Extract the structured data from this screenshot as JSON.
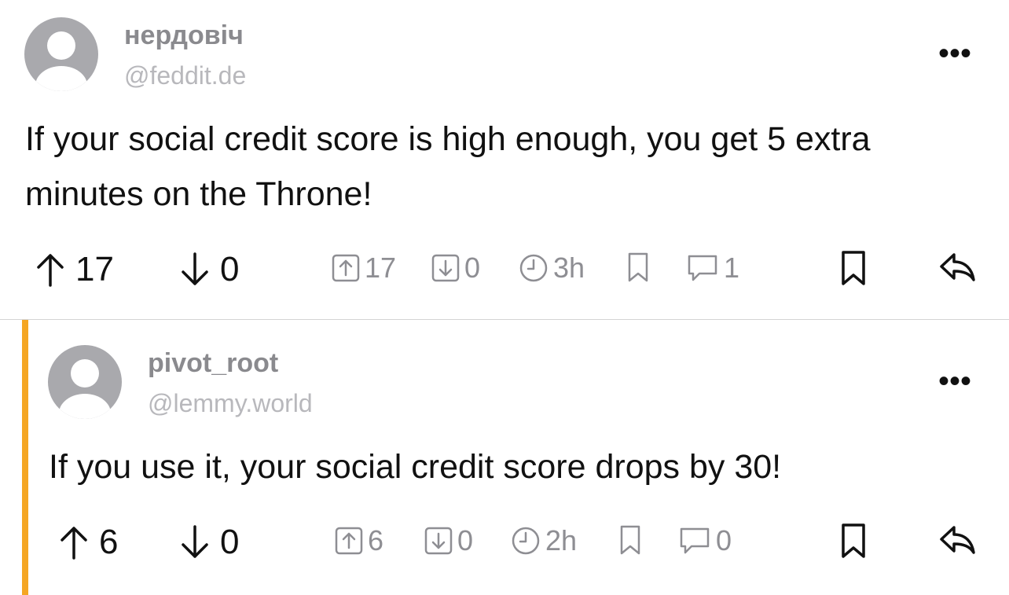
{
  "comments": [
    {
      "username": "нердовіч",
      "instance": "@feddit.de",
      "more": "•••",
      "body": "If your social credit score is high enough, you get 5 extra minutes on the Throne!",
      "upvotes": "17",
      "downvotes": "0",
      "meta_upvotes": "17",
      "meta_downvotes": "0",
      "age": "3h",
      "replies": "1"
    },
    {
      "username": "pivot_root",
      "instance": "@lemmy.world",
      "more": "•••",
      "body": "If you use it, your social credit score drops by 30!",
      "upvotes": "6",
      "downvotes": "0",
      "meta_upvotes": "6",
      "meta_downvotes": "0",
      "age": "2h",
      "replies": "0"
    }
  ],
  "colors": {
    "accent": "#f5a623",
    "muted": "#8e8e93",
    "avatar": "#a9a9ad"
  },
  "icons": [
    "avatar-icon",
    "more-icon",
    "arrow-up-icon",
    "arrow-down-icon",
    "upvote-box-icon",
    "downvote-box-icon",
    "clock-icon",
    "bookmark-icon",
    "comment-icon",
    "save-icon",
    "reply-icon"
  ]
}
